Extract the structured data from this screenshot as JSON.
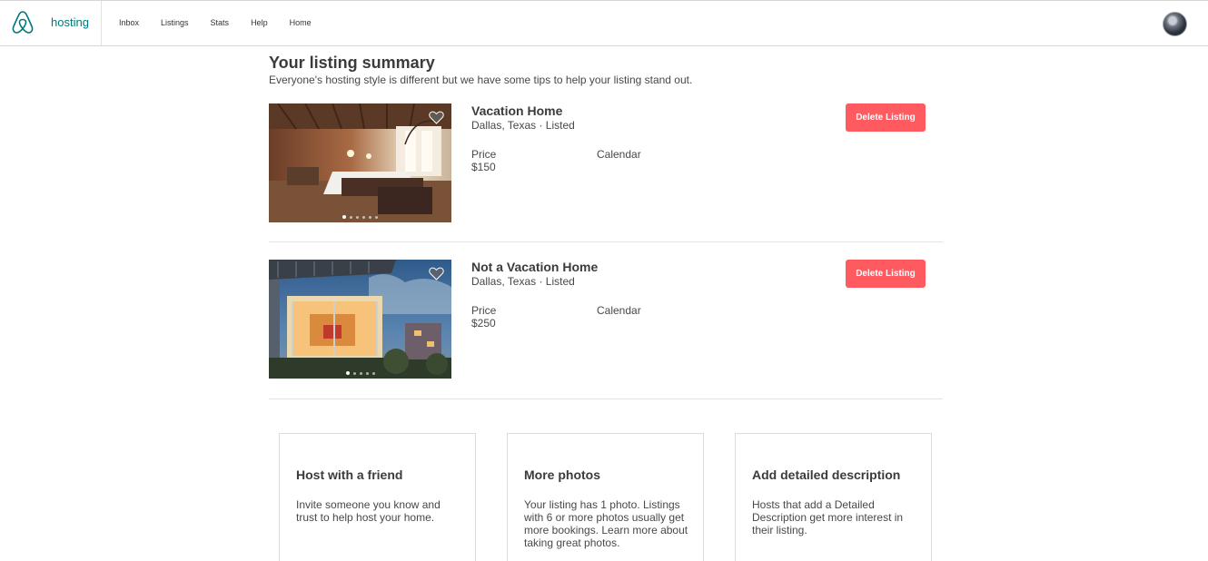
{
  "nav": {
    "brand": "hosting",
    "items": [
      "Inbox",
      "Listings",
      "Stats",
      "Help",
      "Home"
    ]
  },
  "header": {
    "title": "Your listing summary",
    "subtitle": "Everyone's hosting style is different but we have some tips to help your listing stand out."
  },
  "listings": [
    {
      "name": "Vacation Home",
      "location": "Dallas, Texas · Listed",
      "price_label": "Price",
      "price": "$150",
      "calendar_label": "Calendar",
      "delete_label": "Delete Listing"
    },
    {
      "name": "Not a Vacation Home",
      "location": "Dallas, Texas · Listed",
      "price_label": "Price",
      "price": "$250",
      "calendar_label": "Calendar",
      "delete_label": "Delete Listing"
    }
  ],
  "tips": [
    {
      "title": "Host with a friend",
      "text": "Invite someone you know and trust to help host your home."
    },
    {
      "title": "More photos",
      "text": "Your listing has 1 photo. Listings with 6 or more photos usually get more bookings. Learn more about taking great photos."
    },
    {
      "title": "Add detailed description",
      "text": "Hosts that add a Detailed Description get more interest in their listing."
    }
  ],
  "colors": {
    "brand": "#00777a",
    "delete_button": "#ff5a5f"
  },
  "icons": {
    "logo": "airbnb-logo-icon",
    "favorite": "heart-icon",
    "avatar": "user-avatar"
  }
}
